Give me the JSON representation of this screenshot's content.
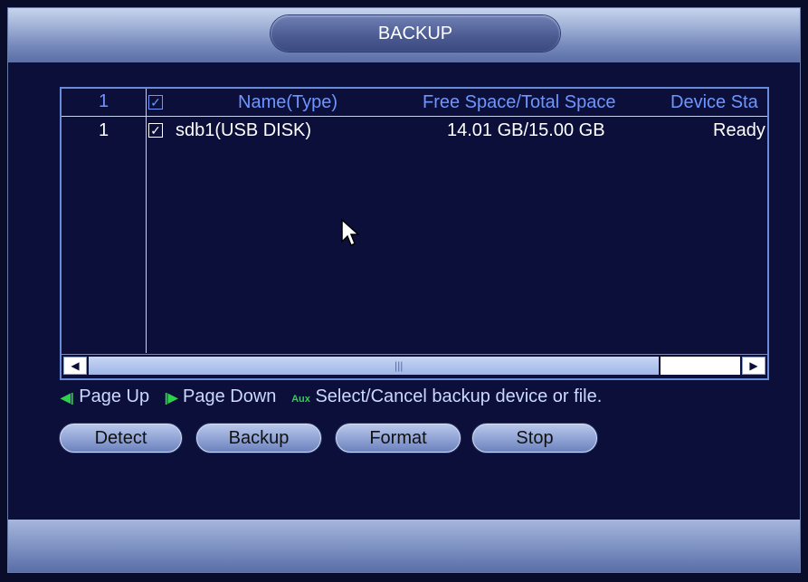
{
  "window": {
    "title": "BACKUP"
  },
  "table": {
    "header": {
      "index": "1",
      "check": "✓",
      "name": "Name(Type)",
      "space": "Free Space/Total Space",
      "status": "Device Sta"
    },
    "rows": [
      {
        "index": "1",
        "check": "✓",
        "name": "sdb1(USB DISK)",
        "space": "14.01 GB/15.00 GB",
        "status": "Ready"
      }
    ]
  },
  "scroll": {
    "left_arrow": "◀",
    "right_arrow": "▶",
    "grip": "|||"
  },
  "hints": {
    "page_up_icon": "◀|",
    "page_up": "Page Up",
    "page_down_icon": "|▶",
    "page_down": "Page Down",
    "aux_icon": "Aux",
    "aux_text": "Select/Cancel backup device or file."
  },
  "buttons": {
    "detect": "Detect",
    "backup": "Backup",
    "format": "Format",
    "stop": "Stop"
  },
  "colors": {
    "accent_header": "#6e96ff",
    "hint_green": "#2fd04a",
    "background": "#0b0f3a"
  }
}
